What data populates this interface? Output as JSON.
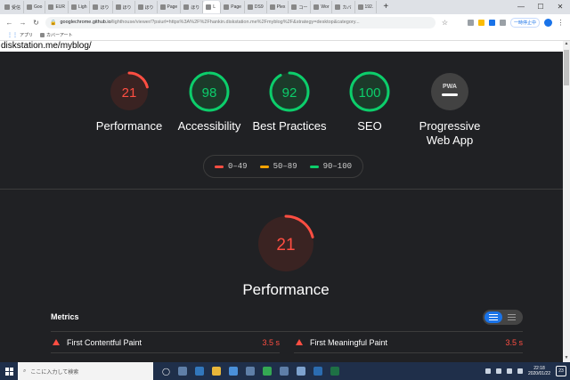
{
  "browser": {
    "tabs": [
      {
        "label": "受信"
      },
      {
        "label": "Goo"
      },
      {
        "label": "EUR"
      },
      {
        "label": "Ligh"
      },
      {
        "label": "ほり"
      },
      {
        "label": "ほり"
      },
      {
        "label": "ほり"
      },
      {
        "label": "Page"
      },
      {
        "label": "ほり"
      },
      {
        "label": "L",
        "active": true
      },
      {
        "label": "Page"
      },
      {
        "label": "DS9"
      },
      {
        "label": "Plex"
      },
      {
        "label": "コー"
      },
      {
        "label": "Wor"
      },
      {
        "label": "カバ"
      },
      {
        "label": "192."
      }
    ],
    "new_tab": "+",
    "window_controls": {
      "min": "—",
      "max": "☐",
      "close": "✕"
    },
    "url_domain": "googlechrome.github.io",
    "url_rest": "/lighthouse/viewer/?psiurl=https%3A%2F%2Fhankin.diskstation.me%2Fmyblog%2F&strategy=desktop&category...",
    "pause_label": "一時停止中",
    "bookmarks": [
      {
        "label": "アプリ"
      },
      {
        "label": "カバーアート"
      }
    ]
  },
  "report": {
    "url": "diskstation.me/myblog/",
    "gauges": [
      {
        "score": "21",
        "label": "Performance",
        "color": "#ff4e42",
        "fraction": 0.21
      },
      {
        "score": "98",
        "label": "Accessibility",
        "color": "#0cce6b",
        "fraction": 0.98
      },
      {
        "score": "92",
        "label": "Best Practices",
        "color": "#0cce6b",
        "fraction": 0.92
      },
      {
        "score": "100",
        "label": "SEO",
        "color": "#0cce6b",
        "fraction": 1.0
      },
      {
        "score": "PWA",
        "label": "Progressive Web App",
        "color": "#9e9e9e",
        "fraction": 0
      }
    ],
    "legend": [
      {
        "range": "0–49",
        "color": "#ff4e42"
      },
      {
        "range": "50–89",
        "color": "#ffa400"
      },
      {
        "range": "90–100",
        "color": "#0cce6b"
      }
    ],
    "main_gauge": {
      "score": "21",
      "title": "Performance",
      "color": "#ff4e42",
      "fraction": 0.21
    },
    "metrics_title": "Metrics",
    "metrics": [
      {
        "name": "First Contentful Paint",
        "value": "3.5 s"
      },
      {
        "name": "First Meaningful Paint",
        "value": "3.5 s"
      }
    ]
  },
  "taskbar": {
    "search_placeholder": "ここに入力して検索",
    "time": "22:18",
    "date": "2020/01/22",
    "notification_count": "23"
  }
}
